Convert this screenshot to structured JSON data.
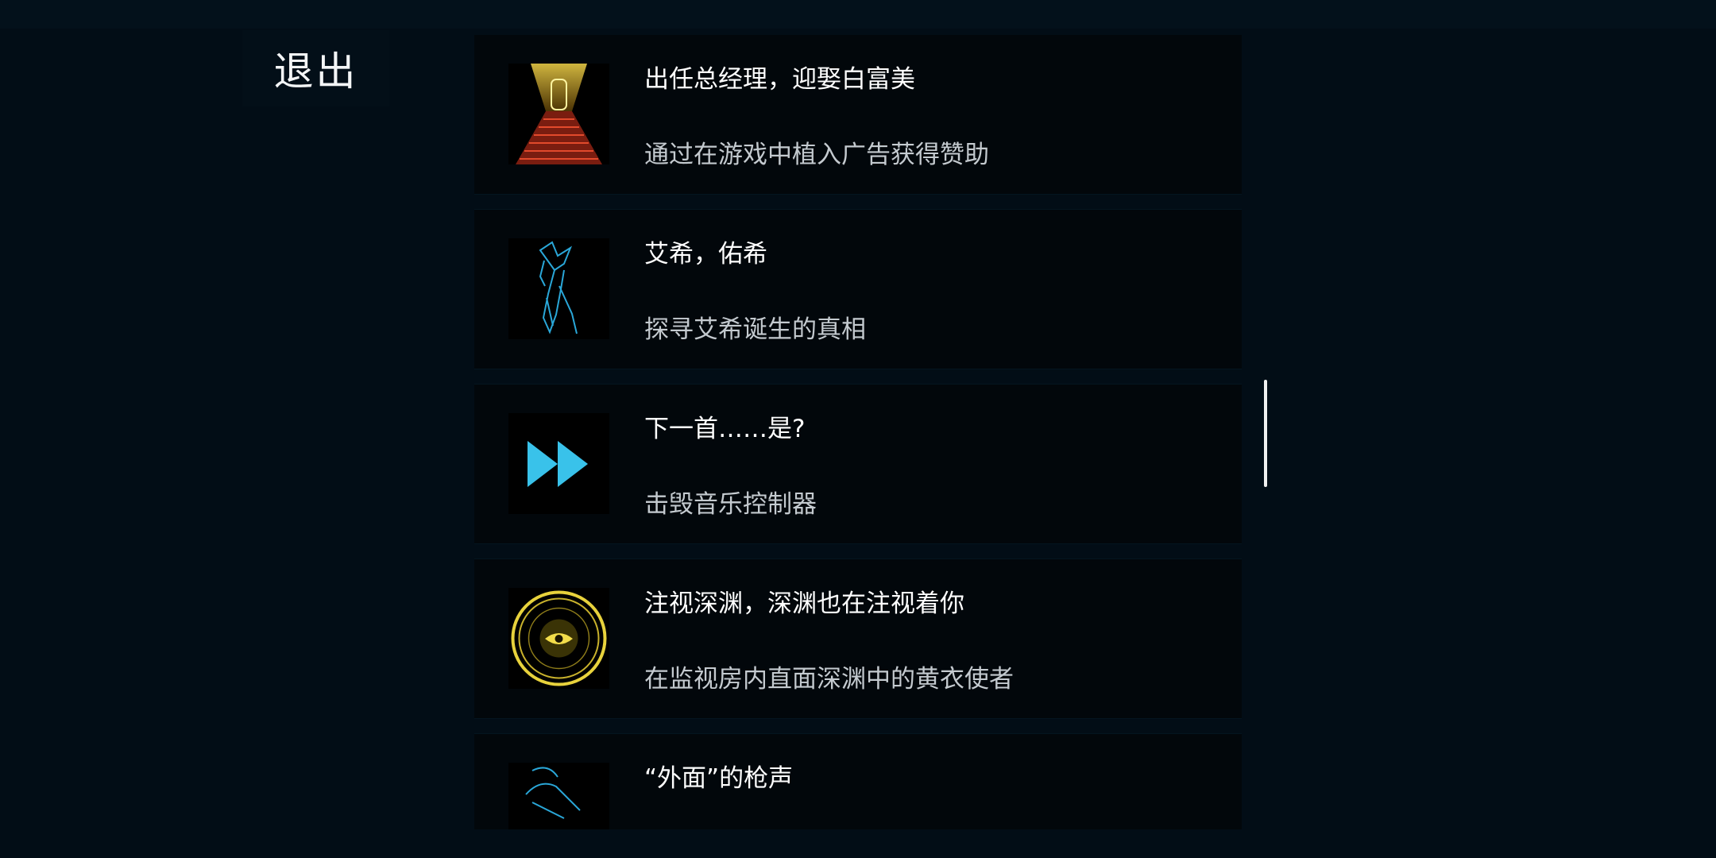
{
  "exit_label": "退出",
  "achievements": [
    {
      "title": "出任总经理，迎娶白富美",
      "description": "通过在游戏中植入广告获得赞助",
      "icon": "golden-corridor-icon",
      "accent": "#d8b23a"
    },
    {
      "title": "艾希，佑希",
      "description": "探寻艾希诞生的真相",
      "icon": "blue-sword-icon",
      "accent": "#2aa7d8"
    },
    {
      "title": "下一首……是?",
      "description": "击毁音乐控制器",
      "icon": "fast-forward-icon",
      "accent": "#39c2ea"
    },
    {
      "title": "注视深渊，深渊也在注视着你",
      "description": "在监视房内直面深渊中的黄衣使者",
      "icon": "eye-seal-icon",
      "accent": "#e8d23c"
    },
    {
      "title": "“外面”的枪声",
      "description": "",
      "icon": "blue-figure-icon",
      "accent": "#2aa7d8"
    }
  ]
}
